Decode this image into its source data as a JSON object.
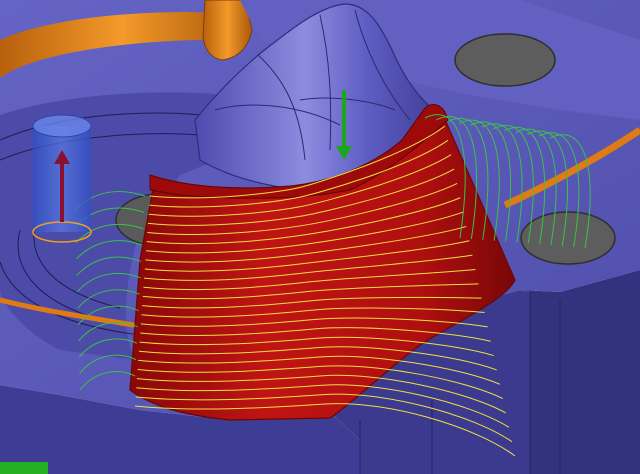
{
  "viewport": {
    "description_free": true,
    "colors": {
      "background": "#ffffff",
      "part_top": "#5a59b7",
      "part_top_light": "#6e6dcd",
      "part_side": "#3a3a8a",
      "part_side_dark": "#2b2b6e",
      "pocket_floor": "#4b4aa6",
      "boss": "#5f5ec6",
      "boss_highlight": "#9b9ae6",
      "orange_part": "#e07b14",
      "orange_dark": "#a8560a",
      "red_surface": "#b40d0d",
      "red_dark": "#7a0707",
      "red_light": "#cc1a1a",
      "toolpath_yellow": "#f0e040",
      "toolpath_green": "#39c24a",
      "hole": "#5b5b5b",
      "tool_cylinder": "#3f63d9",
      "tool_axis": "#8a1030",
      "approach_arrow": "#1aa81a",
      "floor_green": "#22b022"
    },
    "cutting_passes": 24,
    "lead_passes": 12
  }
}
